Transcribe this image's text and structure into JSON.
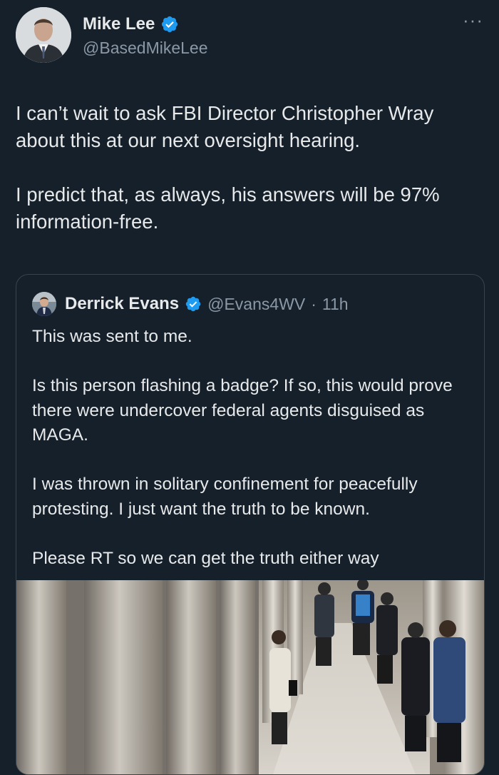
{
  "tweet": {
    "author_name": "Mike Lee",
    "author_handle": "@BasedMikeLee",
    "paragraphs": [
      "I can’t wait to ask FBI Director Christopher Wray about this at our next oversight hearing.",
      "I predict that, as always, his answers will be 97% information-free."
    ],
    "more_icon": "more-options-icon"
  },
  "quote": {
    "author_name": "Derrick Evans",
    "author_handle": "@Evans4WV",
    "separator": "·",
    "time": "11h",
    "paragraphs": [
      "This was sent to me.",
      "Is this person flashing a badge? If so, this would prove there were undercover federal agents disguised as MAGA.",
      "I was thrown in solitary confinement for peacefully protesting. I just want the truth to be known.",
      "Please RT so we can get the truth either way"
    ]
  },
  "colors": {
    "background": "#15202b",
    "text": "#e7e9ea",
    "secondary": "#8b98a5",
    "verified": "#1d9bf0",
    "border": "#38444d"
  }
}
